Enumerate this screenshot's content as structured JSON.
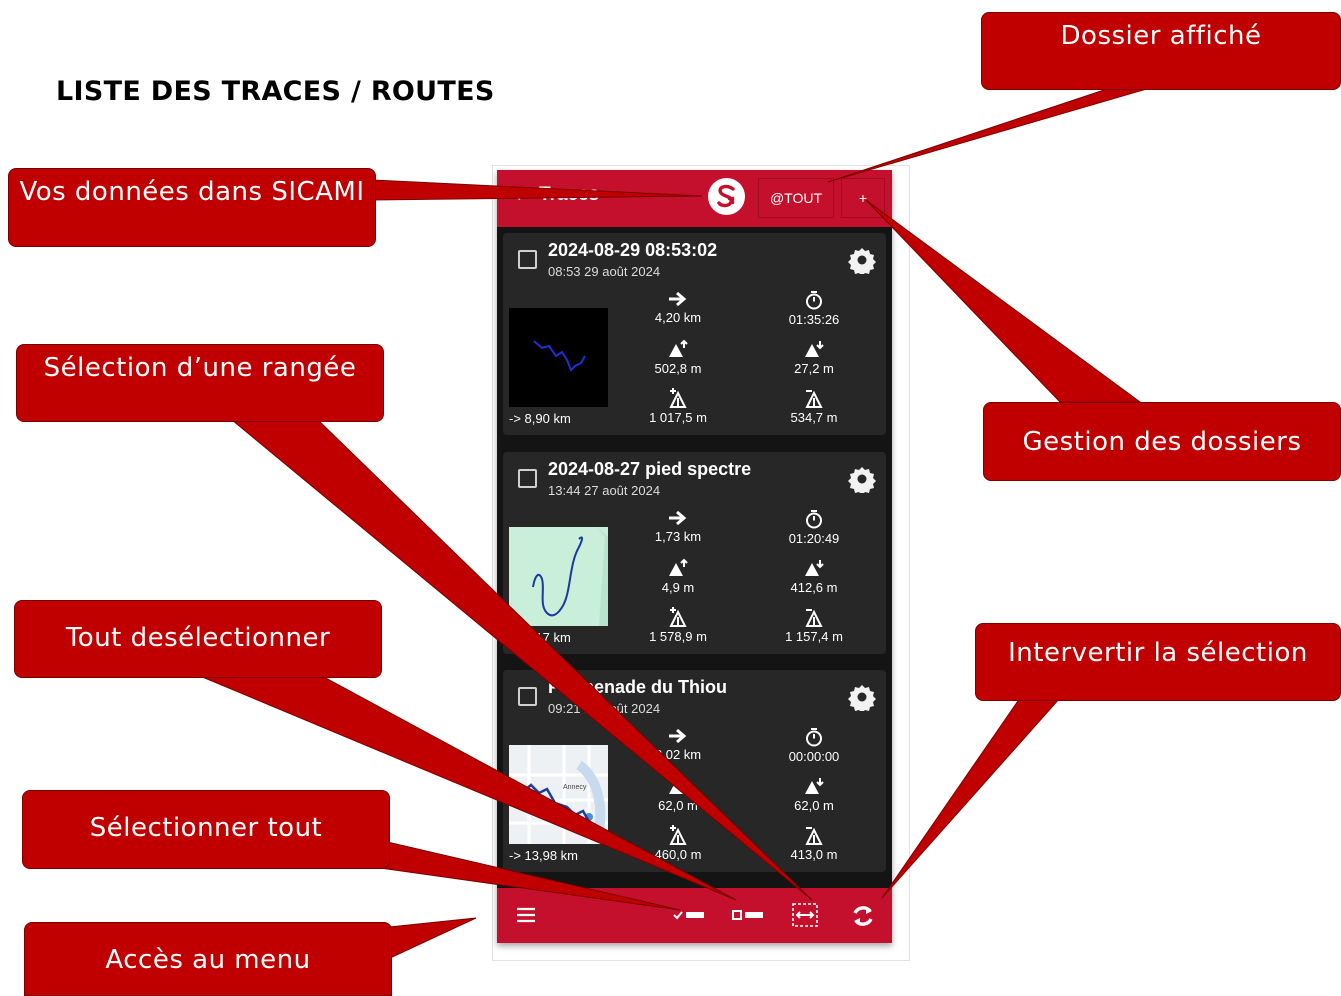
{
  "page_title": "LISTE DES TRACES / ROUTES",
  "app_bar": {
    "back_icon": "back-arrow-icon",
    "title": "Traces",
    "folder_label": "@TOUT",
    "add_label": "+"
  },
  "tracks": [
    {
      "title": "2024-08-29 08:53:02",
      "subtitle": "08:53 29 août 2024",
      "distance": "4,20 km",
      "duration": "01:35:26",
      "elev_gain": "502,8 m",
      "elev_loss": "27,2 m",
      "max_alt": "1 017,5 m",
      "min_alt": "534,7 m",
      "crow_distance": "-> 8,90 km",
      "thumb": "dark"
    },
    {
      "title": "2024-08-27 pied spectre",
      "subtitle": "13:44 27 août 2024",
      "distance": "1,73 km",
      "duration": "01:20:49",
      "elev_gain": "4,9 m",
      "elev_loss": "412,6 m",
      "max_alt": "1 578,9 m",
      "min_alt": "1 157,4 m",
      "crow_distance": "-> 2,17 km",
      "thumb": "green"
    },
    {
      "title": "Promenade du Thiou",
      "subtitle": "09:21 25 août 2024",
      "distance": "3,02 km",
      "duration": "00:00:00",
      "elev_gain": "62,0 m",
      "elev_loss": "62,0 m",
      "max_alt": "460,0 m",
      "min_alt": "413,0 m",
      "crow_distance": "-> 13,98 km",
      "thumb": "map",
      "map_label": "Annecy"
    }
  ],
  "bottom_bar": [
    "menu-icon",
    "select-all-icon",
    "deselect-all-icon",
    "invert-selection-icon",
    "sync-icon"
  ],
  "callouts": {
    "folder_shown": "Dossier affiché",
    "your_data": "Vos données dans SICAMI",
    "row_selection": "Sélection d’une rangée",
    "folder_management": "Gestion des dossiers",
    "deselect_all": "Tout desélectionner",
    "invert_selection": "Intervertir la sélection",
    "select_all": "Sélectionner tout",
    "menu_access": "Accès au menu"
  },
  "colors": {
    "app_red": "#c4102c",
    "callout_red": "#c00000",
    "card_bg": "#272727",
    "screen_bg": "#141414"
  }
}
